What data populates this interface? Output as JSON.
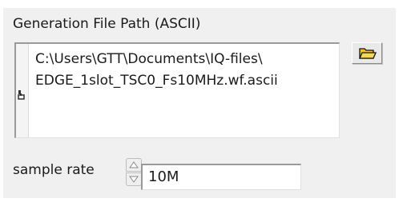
{
  "path_control": {
    "label": "Generation File Path (ASCII)",
    "value": "C:\\Users\\GTT\\Documents\\IQ-files\\\nEDGE_1slot_TSC0_Fs10MHz.wf.ascii",
    "browse_icon": "folder-open-icon",
    "indicator_icon": "path-indicator-icon"
  },
  "sample_rate_control": {
    "label": "sample rate",
    "value": "10M",
    "increment_icon": "up-arrow-icon",
    "decrement_icon": "down-arrow-icon"
  },
  "colors": {
    "panel_background": "#f0f0f0",
    "field_background": "#ffffff",
    "folder_icon": "#f0c419"
  }
}
